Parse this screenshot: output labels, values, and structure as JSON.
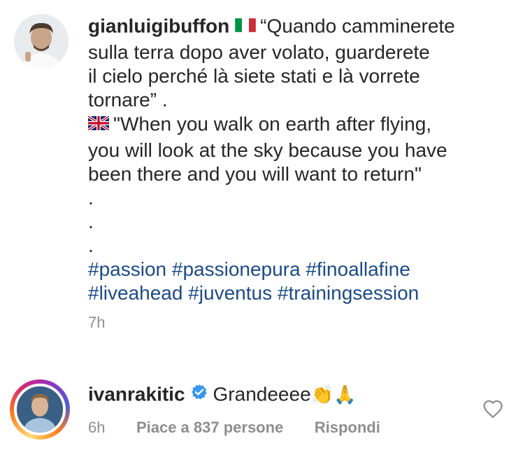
{
  "post": {
    "username": "gianluigibuffon",
    "flag_it_icon": "italy-flag-icon",
    "caption_it_lines": [
      "“Quando camminerete",
      "sulla terra dopo aver volato, guarderete",
      "il cielo perché là siete stati e là vorrete",
      "tornare” ."
    ],
    "flag_uk_icon": "uk-flag-icon",
    "caption_en_lines": [
      "\"When you walk on earth after flying,",
      "you will look at the sky because you have",
      "been there and you will want to return\""
    ],
    "dots": [
      ".",
      ".",
      "."
    ],
    "hashtags_line1": [
      "#passion",
      "#passionepura",
      "#finoallafine"
    ],
    "hashtags_line2": [
      "#liveahead",
      "#juventus",
      "#trainingsession"
    ],
    "time": "7h"
  },
  "comment": {
    "username": "ivanrakitic",
    "verified_icon": "verified-badge-icon",
    "text": "Grandeeee",
    "emojis": "👏🙏",
    "time": "6h",
    "likes": "Piace a 837 persone",
    "reply": "Rispondi",
    "like_icon": "heart-icon"
  }
}
